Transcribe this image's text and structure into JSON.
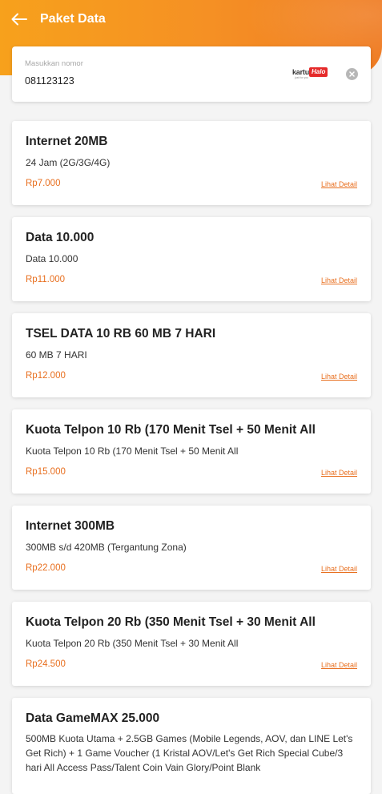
{
  "header": {
    "title": "Paket Data",
    "gradient_colors": [
      "#f7a11c",
      "#ef7b22"
    ]
  },
  "number_input": {
    "label": "Masukkan nomor",
    "value": "081123123",
    "brand_prefix": "kartu",
    "brand_name": "Halo",
    "brand_tagline": "just for you",
    "clear_icon": "close-circle-icon"
  },
  "accent_color": "#e86f1f",
  "packages": [
    {
      "title": "Internet 20MB",
      "desc": "24 Jam (2G/3G/4G)",
      "price": "Rp7.000",
      "detail": "Lihat Detail"
    },
    {
      "title": "Data 10.000",
      "desc": "Data 10.000",
      "price": "Rp11.000",
      "detail": "Lihat Detail"
    },
    {
      "title": "TSEL DATA 10 RB 60 MB 7 HARI",
      "desc": "60 MB 7 HARI",
      "price": "Rp12.000",
      "detail": "Lihat Detail"
    },
    {
      "title": "Kuota Telpon 10 Rb (170 Menit Tsel + 50 Menit All",
      "desc": "Kuota Telpon 10 Rb (170 Menit Tsel + 50 Menit All",
      "price": "Rp15.000",
      "detail": "Lihat Detail"
    },
    {
      "title": "Internet 300MB",
      "desc": "300MB s/d 420MB (Tergantung Zona)",
      "price": "Rp22.000",
      "detail": "Lihat Detail"
    },
    {
      "title": "Kuota Telpon 20 Rb (350 Menit Tsel + 30 Menit All",
      "desc": "Kuota Telpon 20 Rb (350 Menit Tsel + 30 Menit All",
      "price": "Rp24.500",
      "detail": "Lihat Detail"
    },
    {
      "title": "Data GameMAX 25.000",
      "desc": "500MB Kuota Utama + 2.5GB Games (Mobile Legends, AOV, dan LINE Let's Get Rich) + 1 Game Voucher (1 Kristal AOV/Let's Get Rich Special Cube/3 hari All Access Pass/Talent Coin Vain Glory/Point Blank"
    }
  ]
}
